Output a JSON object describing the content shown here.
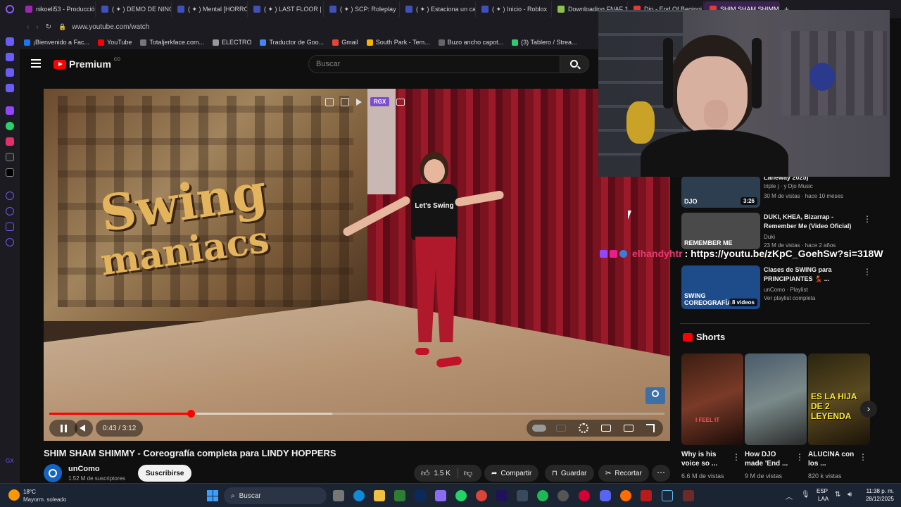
{
  "browser": {
    "tabs": [
      {
        "label": "nikoeli53 - Producció",
        "color": "#9c27b0"
      },
      {
        "label": "( ✦ ) DEMO DE NINO",
        "color": "#3f51b5"
      },
      {
        "label": "( ✦ ) Mental [HORRO",
        "color": "#3f51b5"
      },
      {
        "label": "( ✦ ) LAST FLOOR | J",
        "color": "#3f51b5"
      },
      {
        "label": "( ✦ ) SCP: Roleplay",
        "color": "#3f51b5"
      },
      {
        "label": "( ✦ ) Estaciona un ca",
        "color": "#3f51b5"
      },
      {
        "label": "( ✦ ) Inicio - Roblox",
        "color": "#3f51b5"
      },
      {
        "label": "Downloading FNAF 1",
        "color": "#8bc34a"
      },
      {
        "label": "Djo - End Of Beginni",
        "color": "#e53935"
      },
      {
        "label": "SHIM SHAM SHIMMY",
        "color": "#e53935"
      }
    ],
    "url": "www.youtube.com/watch",
    "bookmarks": [
      {
        "label": "¡Bienvenido a Fac...",
        "color": "#1877f2"
      },
      {
        "label": "YouTube",
        "color": "#ff0000"
      },
      {
        "label": "Totaljerkface.com...",
        "color": "#777"
      },
      {
        "label": "ELECTRO",
        "color": "#999"
      },
      {
        "label": "Traductor de Goo...",
        "color": "#4285f4"
      },
      {
        "label": "Gmail",
        "color": "#ea4335"
      },
      {
        "label": "South Park - Tem...",
        "color": "#f4b400"
      },
      {
        "label": "Buzo ancho capot...",
        "color": "#666"
      },
      {
        "label": "(3) Tablero / Strea...",
        "color": "#2ecc71"
      }
    ]
  },
  "youtube": {
    "logo": "Premium",
    "logo_sup": "CO",
    "search_placeholder": "Buscar",
    "video_title": "SHIM SHAM SHIMMY - Coreografía completa para LINDY HOPPERS",
    "time": "0:43 / 3:12",
    "progress": 0.23,
    "buffered": 0.46,
    "channel": {
      "name": "unComo",
      "subs": "1.52 M de suscriptores",
      "subscribe": "Suscribirse"
    },
    "actions": {
      "likes": "1.5 K",
      "share": "Compartir",
      "save": "Guardar",
      "clip": "Recortar"
    },
    "overlay_badge": "RGX",
    "video_text": {
      "swing": "Swing",
      "maniacs": "maniacs",
      "shirt": "Let's Swing"
    }
  },
  "sidebar": {
    "items": [
      {
        "title": "Laneway 2025)",
        "channel": "triple j · y Djo Music",
        "stats": "30 M de vistas · hace 10 meses",
        "duration": "3:26",
        "thumb_label": "DJO"
      },
      {
        "title": "DUKI, KHEA, Bizarrap - Remember Me (Video Oficial)",
        "channel": "Duki",
        "stats": "23 M de vistas · hace 2 años",
        "thumb_label": "REMEMBER ME"
      },
      {
        "title": "Clases de SWING para PRINCIPIANTES 💃 ...",
        "channel": "unComo · Playlist",
        "stats": "Ver playlist completa",
        "duration": "8 videos",
        "thumb_label": "SWING COREOGRAFÍA"
      }
    ],
    "shorts_title": "Shorts",
    "shorts": [
      {
        "title": "Why is his voice so ...",
        "views": "6.6 M de vistas",
        "label": "I FEEL IT"
      },
      {
        "title": "How DJO made 'End ...",
        "views": "9 M de vistas",
        "label": ""
      },
      {
        "title": "ALUCINA con los ...",
        "views": "820 k vistas",
        "label": "ES LA HIJA DE 2 LEYENDA"
      }
    ]
  },
  "chat": {
    "user": "elhandyhtr",
    "message": ": https://youtu.be/zKpC_GoehSw?si=318W"
  },
  "taskbar": {
    "weather_temp": "18°C",
    "weather_desc": "Mayorm. soleado",
    "search": "Buscar",
    "lang": "ESP",
    "lang2": "LAA",
    "time": "11:38 p. m.",
    "date": "28/12/2025"
  }
}
